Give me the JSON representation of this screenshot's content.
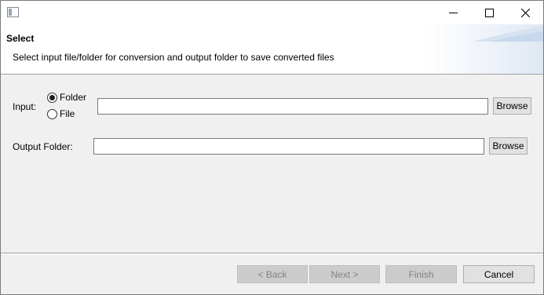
{
  "window": {
    "controls": {
      "minimize_icon": "minimize-icon",
      "maximize_icon": "maximize-icon",
      "close_icon": "close-icon"
    }
  },
  "header": {
    "title": "Select",
    "description": "Select input file/folder for conversion and output folder to save converted files"
  },
  "form": {
    "input_label": "Input:",
    "radio_options": [
      {
        "label": "Folder",
        "checked": true
      },
      {
        "label": "File",
        "checked": false
      }
    ],
    "input_path_value": "",
    "input_browse_label": "Browse",
    "output_label": "Output Folder:",
    "output_path_value": "",
    "output_browse_label": "Browse"
  },
  "footer": {
    "back_label": "< Back",
    "next_label": "Next >",
    "finish_label": "Finish",
    "cancel_label": "Cancel"
  }
}
